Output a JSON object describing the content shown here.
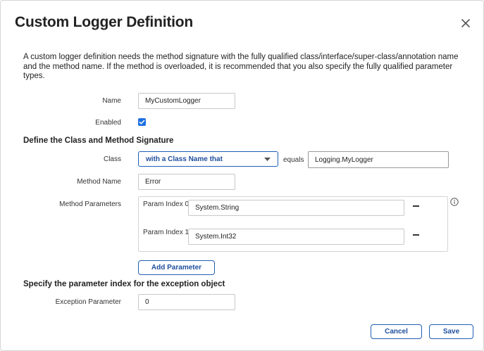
{
  "dialog": {
    "title": "Custom Logger Definition",
    "description": "A custom logger definition needs the method signature with the fully qualified class/interface/super-class/annotation name and the method name. If the method is overloaded, it is recommended that you also specify the fully qualified parameter types."
  },
  "fields": {
    "name_label": "Name",
    "name_value": "MyCustomLogger",
    "enabled_label": "Enabled",
    "enabled_checked": true
  },
  "signature": {
    "section_title": "Define the Class and Method Signature",
    "class_label": "Class",
    "class_match_selected": "with a Class Name that",
    "equals_label": "equals",
    "class_value": "Logging.MyLogger",
    "method_name_label": "Method Name",
    "method_name_value": "Error",
    "method_params_label": "Method Parameters",
    "params": [
      {
        "label": "Param Index 0",
        "value": "System.String"
      },
      {
        "label": "Param Index 1",
        "value": "System.Int32"
      }
    ],
    "add_param_label": "Add Parameter"
  },
  "exception": {
    "section_title": "Specify the parameter index for the exception object",
    "label": "Exception Parameter",
    "value": "0"
  },
  "footer": {
    "cancel_label": "Cancel",
    "save_label": "Save"
  },
  "icons": {
    "close": "close-icon",
    "check": "checkmark-icon",
    "caret": "chevron-down-icon",
    "remove": "minus-icon",
    "info": "info-icon"
  },
  "colors": {
    "accent": "#1f5fb4",
    "checkbox": "#1d6fe0"
  }
}
